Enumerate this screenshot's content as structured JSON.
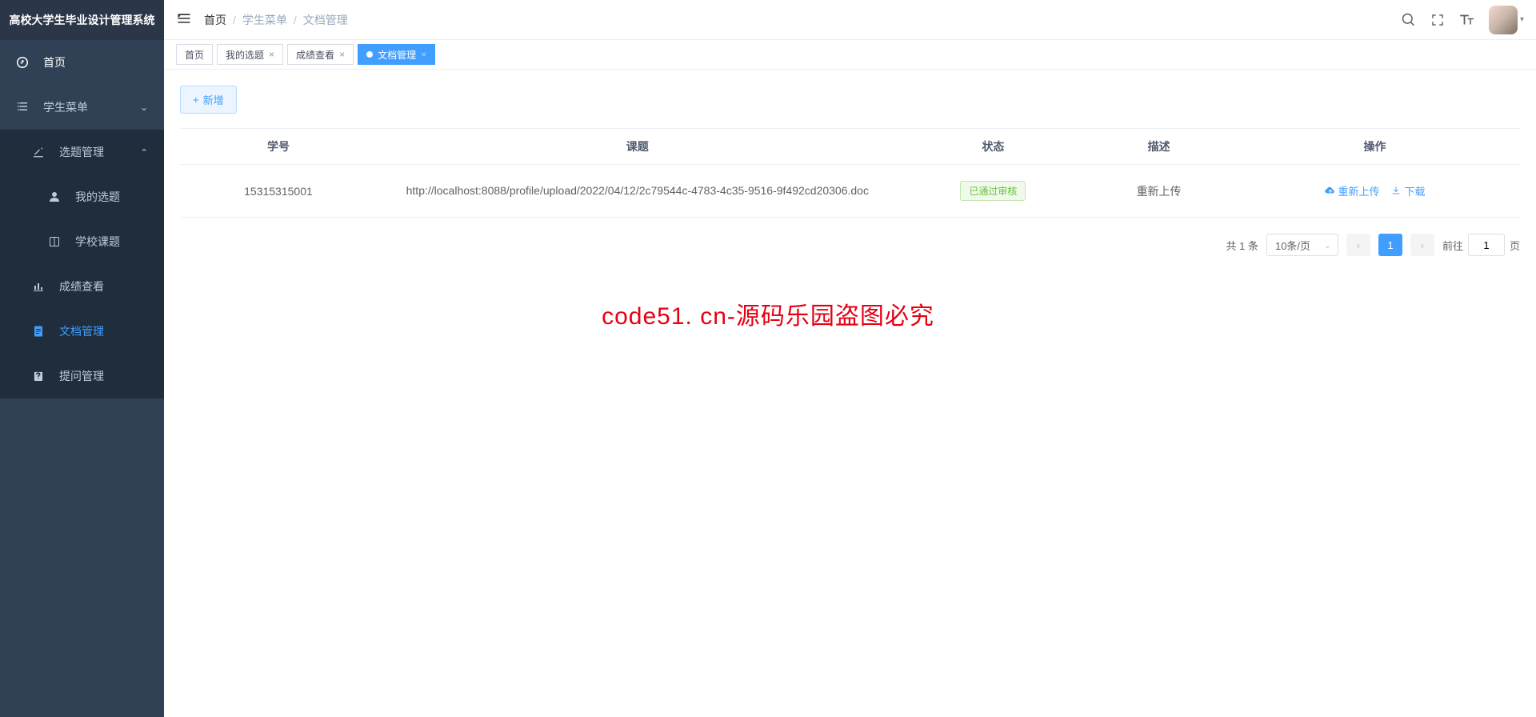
{
  "app_title": "高校大学生毕业设计管理系统",
  "breadcrumb": [
    "首页",
    "学生菜单",
    "文档管理"
  ],
  "sidebar": {
    "home": "首页",
    "student_menu": "学生菜单",
    "topic_mgmt": "选题管理",
    "my_topic": "我的选题",
    "school_topic": "学校课题",
    "grade_view": "成绩查看",
    "doc_mgmt": "文档管理",
    "qa_mgmt": "提问管理"
  },
  "tabs": [
    {
      "label": "首页",
      "closable": false,
      "active": false
    },
    {
      "label": "我的选题",
      "closable": true,
      "active": false
    },
    {
      "label": "成绩查看",
      "closable": true,
      "active": false
    },
    {
      "label": "文档管理",
      "closable": true,
      "active": true
    }
  ],
  "buttons": {
    "add": "新增"
  },
  "table": {
    "columns": [
      "学号",
      "课题",
      "状态",
      "描述",
      "操作"
    ],
    "rows": [
      {
        "sid": "15315315001",
        "topic": "http://localhost:8088/profile/upload/2022/04/12/2c79544c-4783-4c35-9516-9f492cd20306.doc",
        "status": "已通过审核",
        "desc": "重新上传",
        "op_reupload": "重新上传",
        "op_download": "下载"
      }
    ]
  },
  "pagination": {
    "total_label": "共 1 条",
    "page_size_label": "10条/页",
    "current": "1",
    "jump_prefix": "前往",
    "jump_value": "1",
    "jump_suffix": "页"
  },
  "watermark": "code51. cn-源码乐园盗图必究"
}
